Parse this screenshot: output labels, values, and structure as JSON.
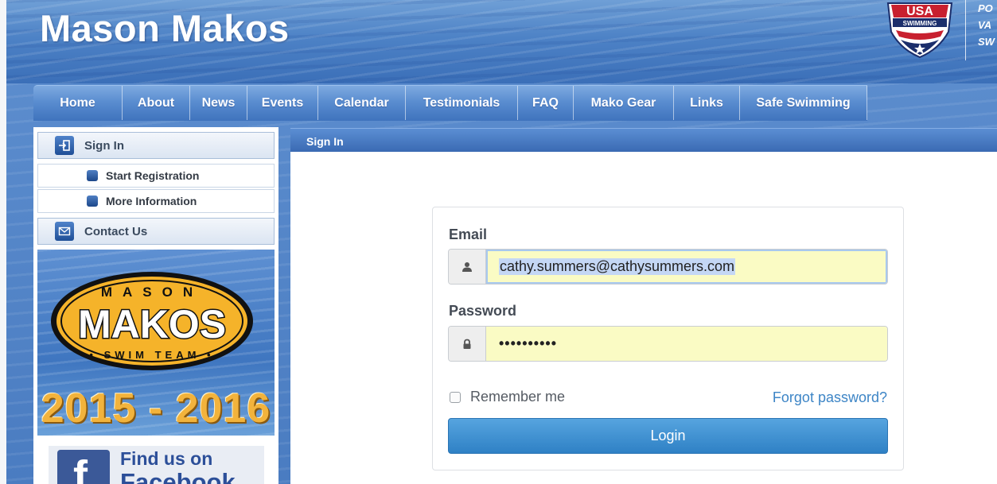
{
  "site": {
    "title": "Mason Makos",
    "badge_text": "USA SWIMMING",
    "sponsor_lines": [
      "PO",
      "VA",
      "SW"
    ]
  },
  "nav": {
    "items": [
      {
        "label": "Home"
      },
      {
        "label": "About"
      },
      {
        "label": "News"
      },
      {
        "label": "Events"
      },
      {
        "label": "Calendar"
      },
      {
        "label": "Testimonials"
      },
      {
        "label": "FAQ"
      },
      {
        "label": "Mako Gear"
      },
      {
        "label": "Links"
      },
      {
        "label": "Safe Swimming"
      }
    ]
  },
  "sidebar": {
    "sign_in": "Sign In",
    "start_registration": "Start Registration",
    "more_information": "More Information",
    "contact_us": "Contact Us",
    "logo": {
      "top": "MASON",
      "name": "MAKOS",
      "bottom": "• SWIM TEAM •"
    },
    "season": "2015 - 2016",
    "facebook": {
      "glyph": "f",
      "line1": "Find us on",
      "line2": "Facebook"
    }
  },
  "main": {
    "section_title": "Sign In"
  },
  "login": {
    "email_label": "Email",
    "email_value": "cathy.summers@cathysummers.com",
    "password_label": "Password",
    "password_value": "••••••••••",
    "remember_label": "Remember me",
    "remember_checked": false,
    "forgot_label": "Forgot password?",
    "submit_label": "Login"
  },
  "colors": {
    "accent": "#3d85c6",
    "button": "#3a8fd0",
    "autofill": "#fafbc4",
    "header_blue": "#4d82c6"
  }
}
